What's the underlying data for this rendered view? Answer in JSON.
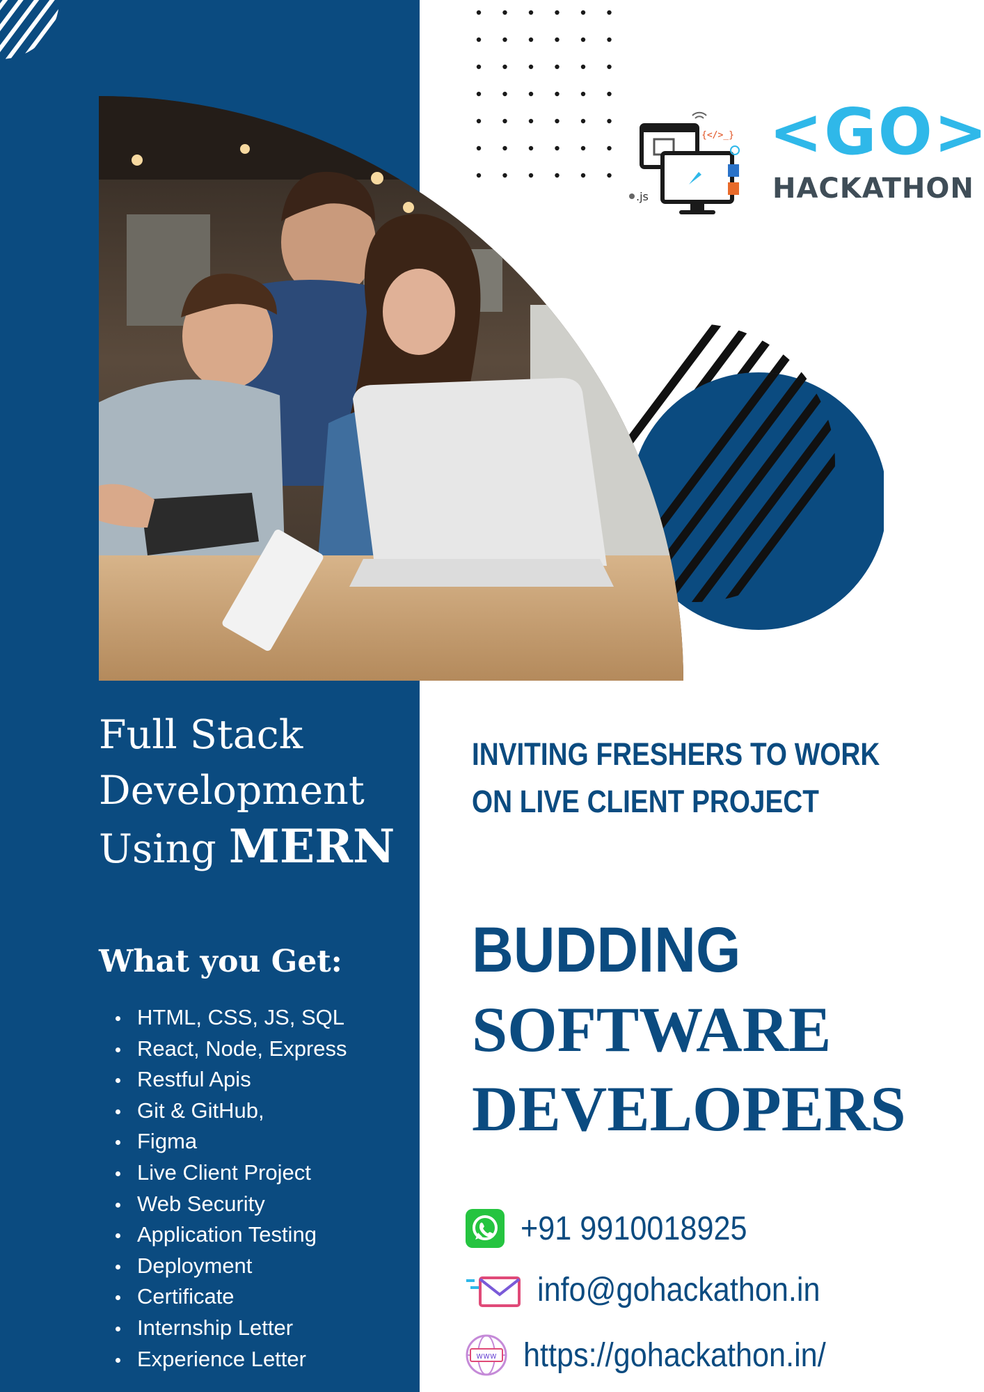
{
  "brand": {
    "logo_main": "<GO>",
    "logo_sub": "HACKATHON",
    "primary_color": "#0b4b80",
    "accent_color": "#2fb8e9"
  },
  "course": {
    "line1": "Full Stack",
    "line2": "Development",
    "line3_prefix": "Using",
    "line3_strong": "MERN"
  },
  "benefits": {
    "title": "What you Get:",
    "items": [
      "HTML, CSS, JS, SQL",
      "React, Node, Express",
      "Restful Apis",
      "Git & GitHub,",
      "Figma",
      "Live Client Project",
      "Web Security",
      "Application Testing",
      "Deployment",
      "Certificate",
      "Internship Letter",
      "Experience Letter"
    ]
  },
  "invite": {
    "line1": "INVITING FRESHERS TO WORK",
    "line2": "ON LIVE CLIENT PROJECT"
  },
  "headline": {
    "line1": "BUDDING",
    "line2": "SOFTWARE",
    "line3": "DEVELOPERS"
  },
  "contact": {
    "phone": "+91 9910018925",
    "email": "info@gohackathon.in",
    "website": "https://gohackathon.in/",
    "phone_icon": "whatsapp-icon",
    "email_icon": "mail-icon",
    "web_icon": "globe-www-icon"
  }
}
